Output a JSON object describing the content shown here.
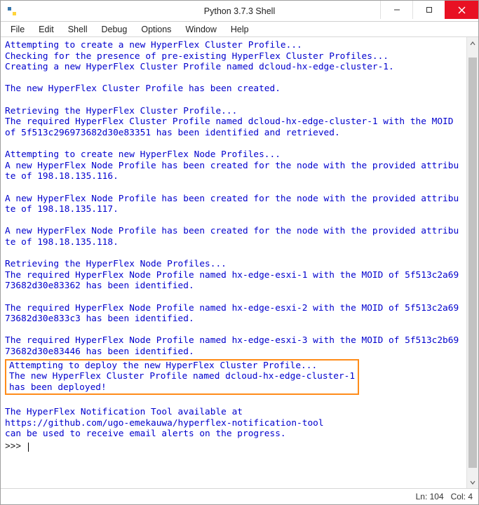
{
  "window": {
    "title": "Python 3.7.3 Shell"
  },
  "menu": {
    "items": [
      "File",
      "Edit",
      "Shell",
      "Debug",
      "Options",
      "Window",
      "Help"
    ]
  },
  "output": {
    "block1": "Attempting to create a new HyperFlex Cluster Profile...\nChecking for the presence of pre-existing HyperFlex Cluster Profiles...\nCreating a new HyperFlex Cluster Profile named dcloud-hx-edge-cluster-1.\n\nThe new HyperFlex Cluster Profile has been created.\n\nRetrieving the HyperFlex Cluster Profile...\nThe required HyperFlex Cluster Profile named dcloud-hx-edge-cluster-1 with the MOID of 5f513c296973682d30e83351 has been identified and retrieved.\n\nAttempting to create new HyperFlex Node Profiles...\nA new HyperFlex Node Profile has been created for the node with the provided attribute of 198.18.135.116.\n\nA new HyperFlex Node Profile has been created for the node with the provided attribute of 198.18.135.117.\n\nA new HyperFlex Node Profile has been created for the node with the provided attribute of 198.18.135.118.\n\nRetrieving the HyperFlex Node Profiles...\nThe required HyperFlex Node Profile named hx-edge-esxi-1 with the MOID of 5f513c2a6973682d30e83362 has been identified.\n\nThe required HyperFlex Node Profile named hx-edge-esxi-2 with the MOID of 5f513c2a6973682d30e833c3 has been identified.\n\nThe required HyperFlex Node Profile named hx-edge-esxi-3 with the MOID of 5f513c2b6973682d30e83446 has been identified.\n",
    "highlighted": "Attempting to deploy the new HyperFlex Cluster Profile...\nThe new HyperFlex Cluster Profile named dcloud-hx-edge-cluster-1\nhas been deployed!",
    "block2": "\nThe HyperFlex Notification Tool available at\nhttps://github.com/ugo-emekauwa/hyperflex-notification-tool\ncan be used to receive email alerts on the progress.\n"
  },
  "prompt": ">>> ",
  "status": {
    "line": "Ln: 104",
    "col": "Col: 4"
  },
  "scrollbar": {
    "thumb_top_pct": 2,
    "thumb_height_pct": 96
  }
}
